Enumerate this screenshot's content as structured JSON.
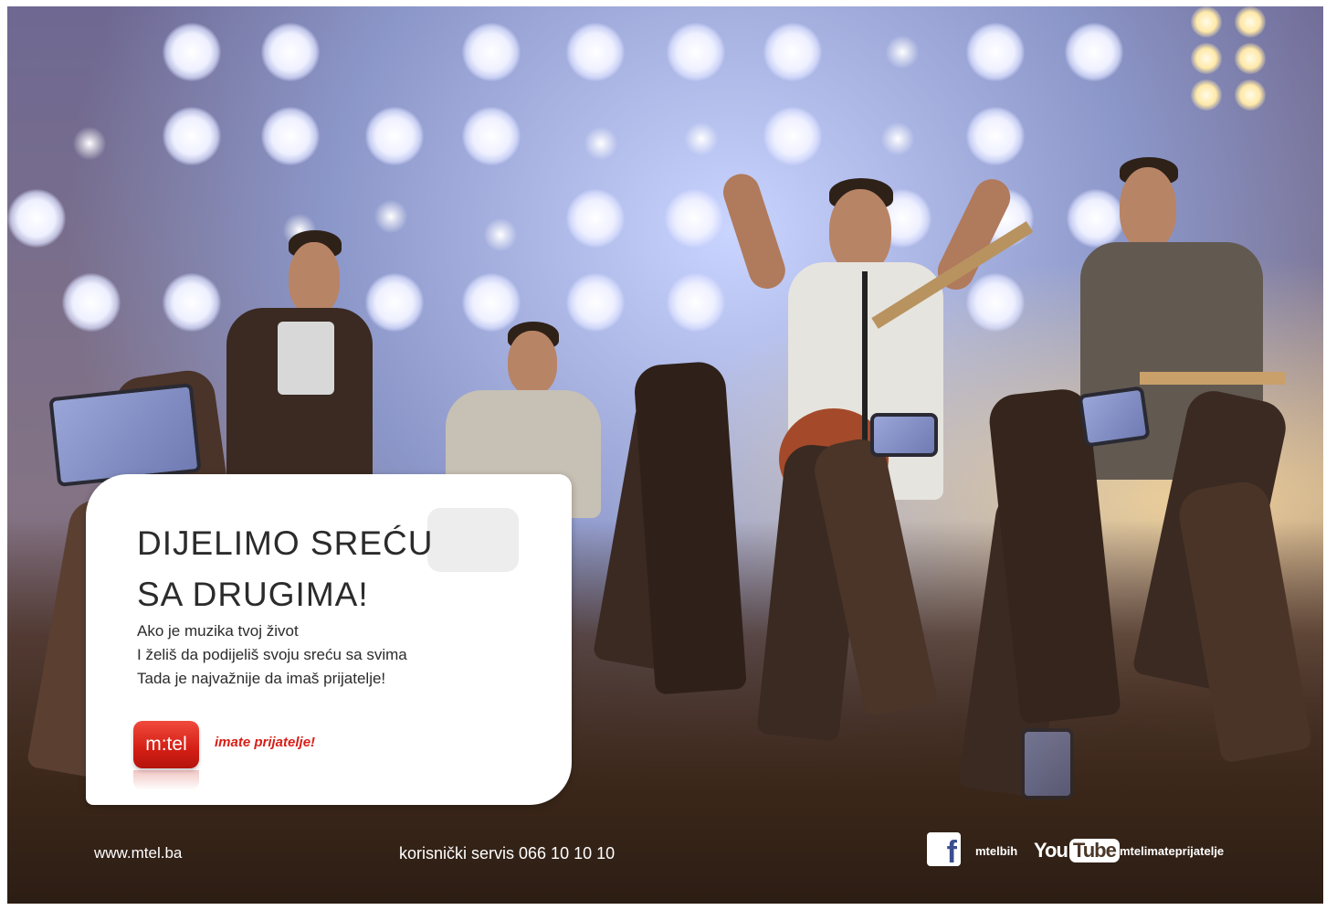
{
  "card": {
    "headline_line1": "DIJELIMO SREĆU",
    "headline_line2": "SA DRUGIMA!",
    "body_line1": "Ako je muzika tvoj život",
    "body_line2": "I želiš da podijeliš svoju sreću sa svima",
    "body_line3": "Tada je najvažnije da imaš prijatelje!",
    "logo_text": "m:tel",
    "tagline": "imate prijatelje!"
  },
  "footer": {
    "website": "www.mtel.ba",
    "service": "korisnički servis 066 10 10 10",
    "facebook_glyph": "f",
    "facebook_handle": "mtelbih",
    "youtube_you": "You",
    "youtube_tube": "Tube",
    "youtube_handle": "mtelimateprijatelje"
  },
  "colors": {
    "brand_red": "#d81e16",
    "card_text": "#2b2b2b",
    "facebook_blue": "#3b4f8f"
  },
  "icons": [
    "facebook-icon",
    "youtube-logo",
    "mtel-logo"
  ]
}
